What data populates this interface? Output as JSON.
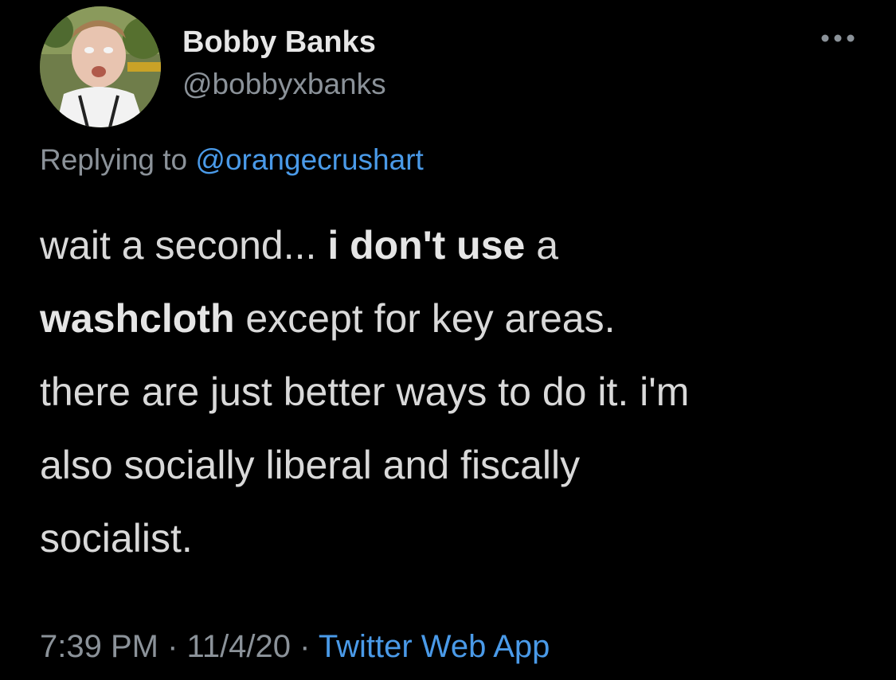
{
  "user": {
    "display_name": "Bobby Banks",
    "handle": "@bobbyxbanks"
  },
  "reply": {
    "prefix": "Replying to",
    "mention": "@orangecrushart"
  },
  "tweet": {
    "segments": {
      "s1": "wait a second... ",
      "s2": "i don't use",
      "s3": " a",
      "s4": "washcloth",
      "s5": " except for key areas.",
      "s6": "there are just better ways to do it. i'm",
      "s7": "also socially liberal and fiscally",
      "s8": "socialist."
    }
  },
  "meta": {
    "time": "7:39 PM",
    "separator": "·",
    "date": "11/4/20",
    "source": "Twitter Web App"
  },
  "icons": {
    "more": "more-horizontal-icon",
    "avatar": "profile-photo"
  },
  "colors": {
    "background": "#000000",
    "link": "#4a9ae8",
    "secondary_text": "#8b9299",
    "primary_text": "#d9d9d9"
  }
}
